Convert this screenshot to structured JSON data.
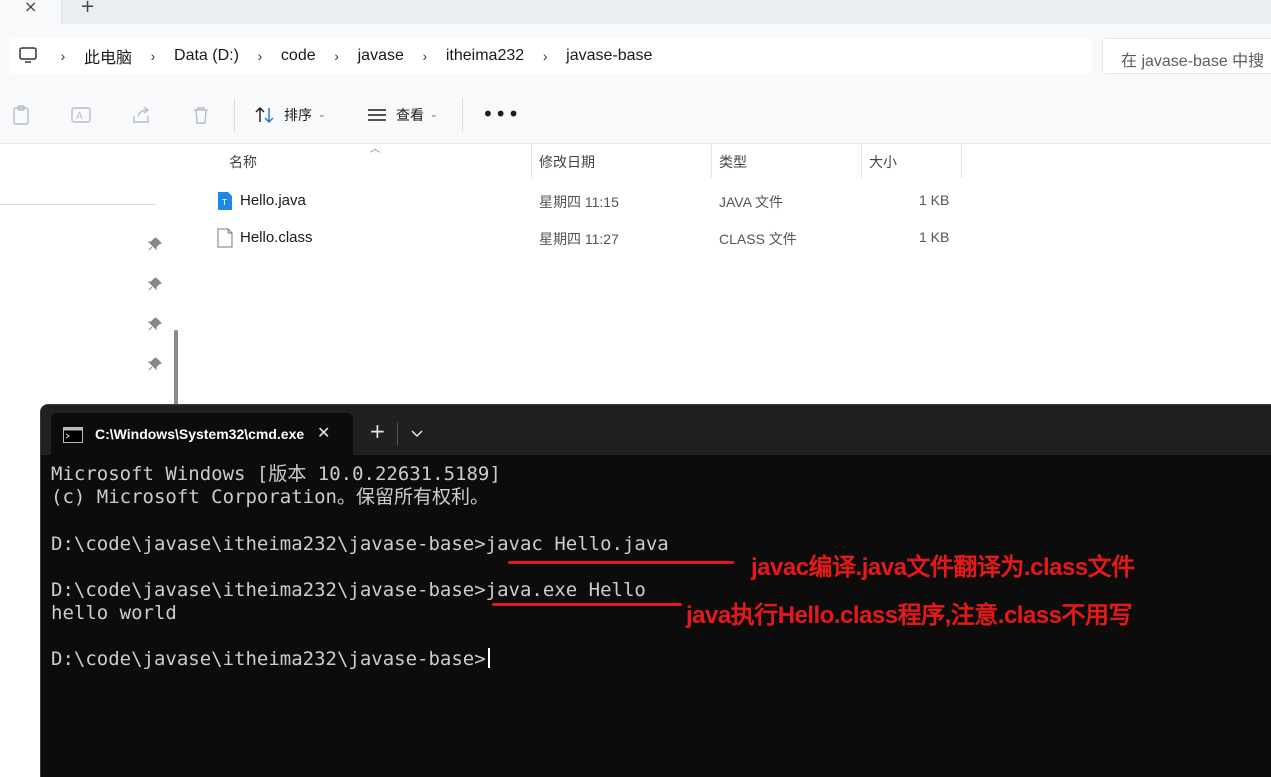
{
  "explorer": {
    "address": {
      "crumbs": [
        "此电脑",
        "Data (D:)",
        "code",
        "javase",
        "itheima232",
        "javase-base"
      ],
      "search_placeholder": "在 javase-base 中搜"
    },
    "toolbar": {
      "sort_label": "排序",
      "view_label": "查看"
    },
    "columns": {
      "name": "名称",
      "date": "修改日期",
      "type": "类型",
      "size": "大小"
    },
    "files": [
      {
        "name": "Hello.java",
        "date": "星期四 11:15",
        "type": "JAVA 文件",
        "size": "1 KB",
        "icon": "java-file-icon"
      },
      {
        "name": "Hello.class",
        "date": "星期四 11:27",
        "type": "CLASS 文件",
        "size": "1 KB",
        "icon": "generic-file-icon"
      }
    ]
  },
  "cmd": {
    "tab_title": "C:\\Windows\\System32\\cmd.exe",
    "lines": [
      "Microsoft Windows [版本 10.0.22631.5189]",
      "(c) Microsoft Corporation。保留所有权利。",
      "",
      "D:\\code\\javase\\itheima232\\javase-base>javac Hello.java",
      "",
      "D:\\code\\javase\\itheima232\\javase-base>java.exe Hello",
      "hello world",
      "",
      "D:\\code\\javase\\itheima232\\javase-base>"
    ]
  },
  "annotations": {
    "javac_note": "javac编译.java文件翻译为.class文件",
    "java_note": "java执行Hello.class程序,注意.class不用写",
    "color": "#e61919"
  }
}
